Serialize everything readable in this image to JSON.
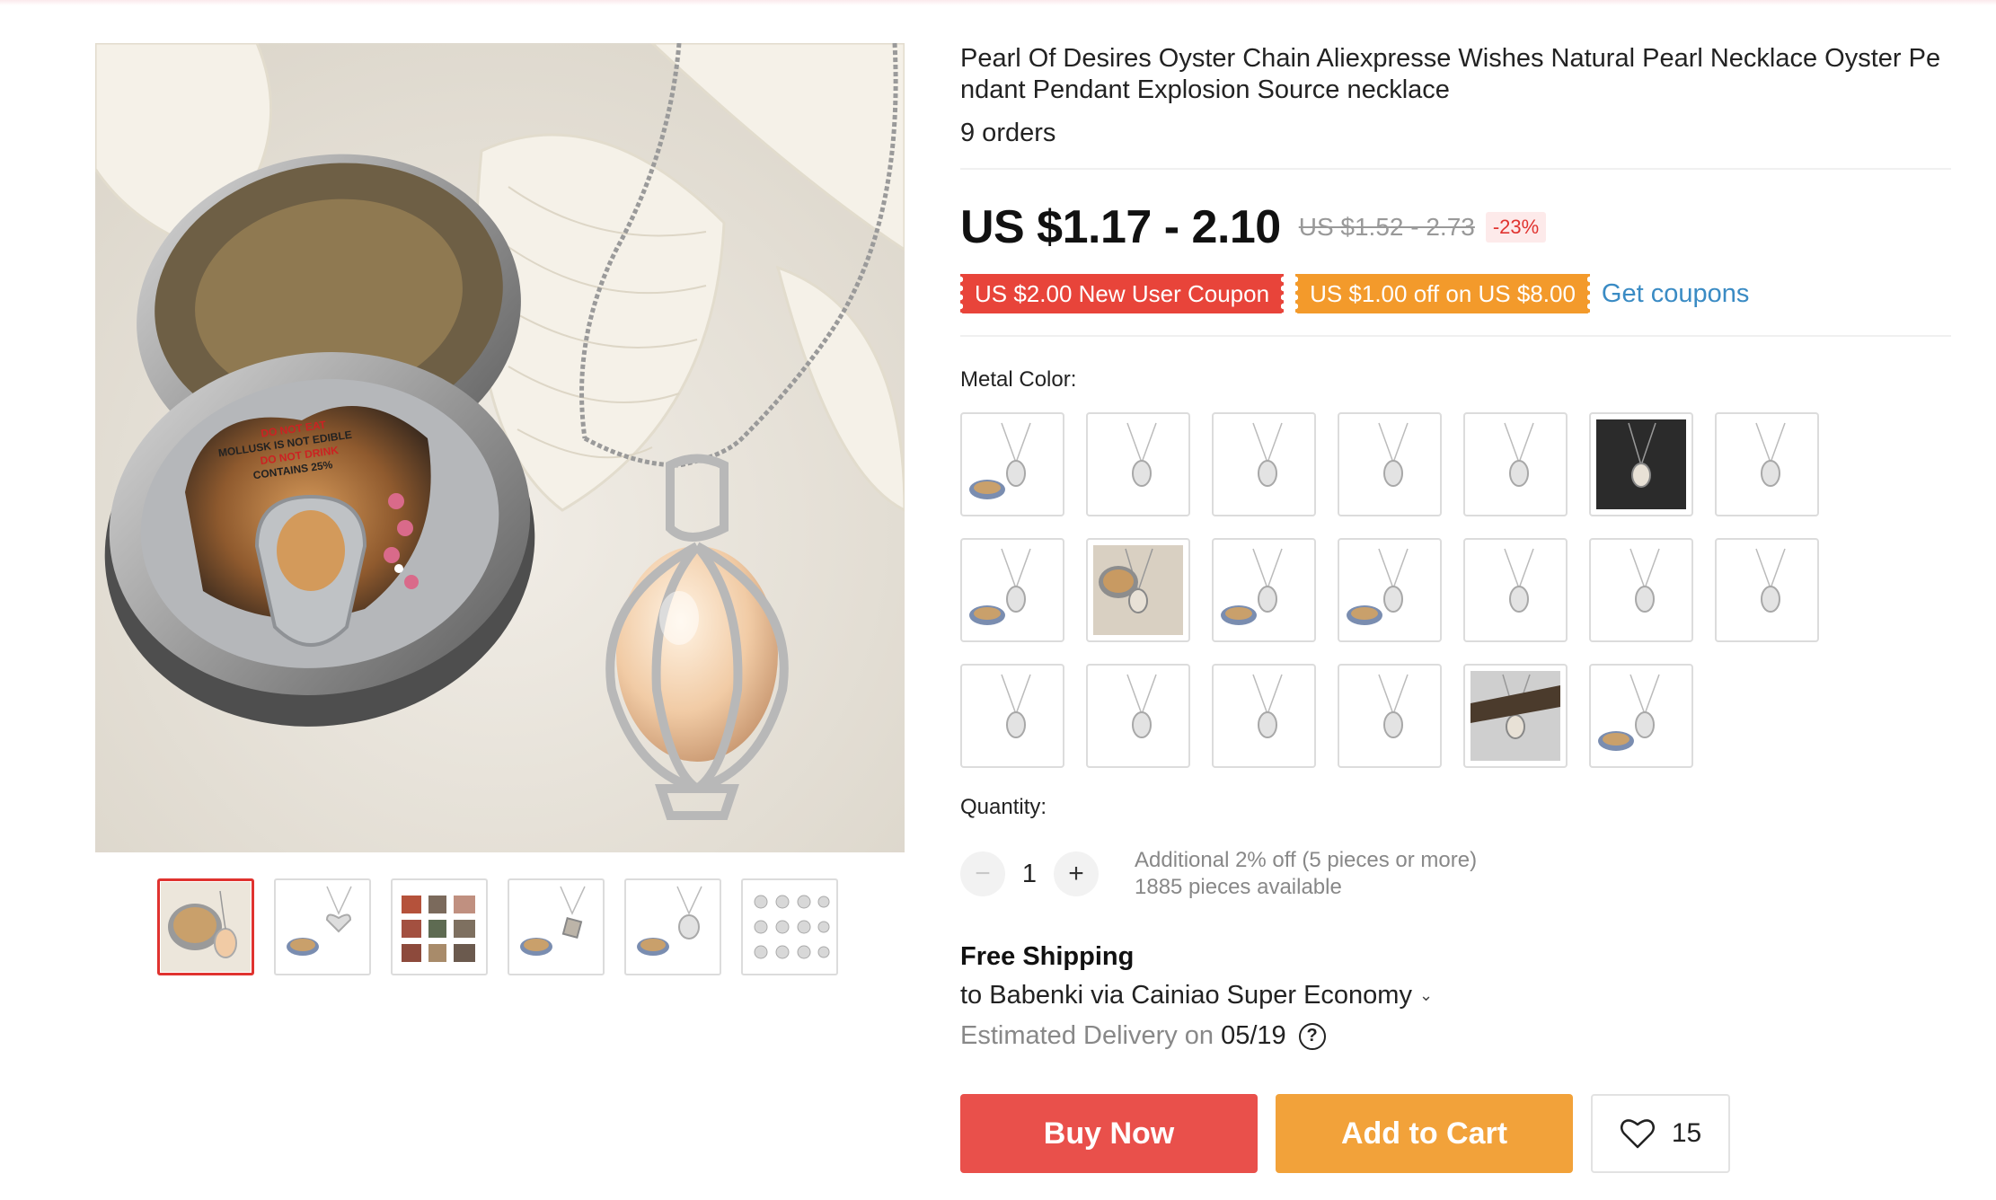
{
  "product": {
    "title": "Pearl Of Desires Oyster Chain Aliexpresse Wishes Natural Pearl Necklace Oyster Pendant Pendant Explosion Source necklace",
    "orders": "9 orders"
  },
  "gallery": {
    "main_image_icon": "oyster-pearl-cage-necklace-image",
    "package_text": [
      "DO NOT EAT",
      "MOLLUSK IS NOT EDIBLE",
      "DO NOT DRINK",
      "CONTAINS 25%"
    ],
    "thumbnails": [
      {
        "icon": "oyster-can-pendant-thumb",
        "active": true
      },
      {
        "icon": "heart-pendant-thumb",
        "active": false
      },
      {
        "icon": "collage-thumb",
        "active": false
      },
      {
        "icon": "cube-pendant-thumb",
        "active": false
      },
      {
        "icon": "turtle-pendant-thumb",
        "active": false
      },
      {
        "icon": "pendant-grid-thumb",
        "active": false
      }
    ]
  },
  "price": {
    "current": "US $1.17 - 2.10",
    "original": "US $1.52 - 2.73",
    "discount": "-23%"
  },
  "coupons": {
    "new_user": "US $2.00 New User Coupon",
    "spend_off": "US $1.00 off on US $8.00",
    "get_link": "Get coupons",
    "colors": {
      "red": "#e8443a",
      "orange": "#f39a2b",
      "link": "#3a8bc4"
    }
  },
  "metal_color": {
    "label": "Metal Color:",
    "options": [
      "heart-with-can",
      "mermaid",
      "turtle",
      "drop",
      "teardrop",
      "photo-dark",
      "heart",
      "heart-cage-with-can",
      "photo-can",
      "flower-with-can",
      "cube-with-can",
      "heart-filigree",
      "flower-small",
      "cat",
      "love-letters",
      "fairy",
      "elephant",
      "cross",
      "photo-beach",
      "oval-with-can"
    ]
  },
  "quantity": {
    "label": "Quantity:",
    "minus": "−",
    "value": "1",
    "plus": "+",
    "bulk_note": "Additional 2% off (5 pieces or more)",
    "available": "1885 pieces available"
  },
  "shipping": {
    "title": "Free Shipping",
    "destination": "to Babenki via Cainiao Super Economy",
    "chevron": "⌄",
    "estimated_label": "Estimated Delivery on",
    "date": "05/19",
    "help": "?"
  },
  "actions": {
    "buy_now": "Buy Now",
    "add_to_cart": "Add to Cart",
    "wishlist_count": "15",
    "colors": {
      "buy": "#e9504b",
      "cart": "#f2a23a"
    }
  }
}
